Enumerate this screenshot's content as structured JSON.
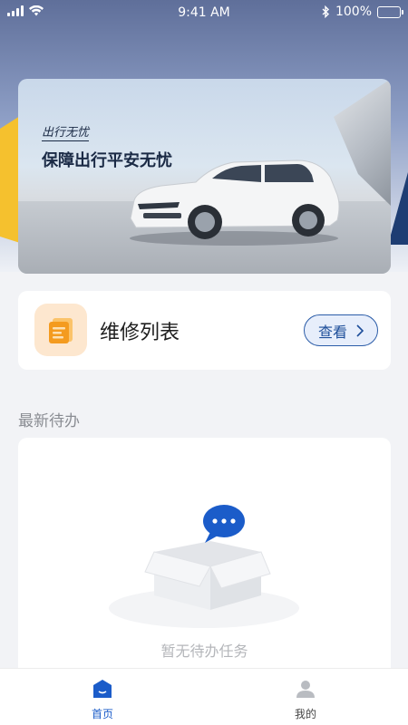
{
  "status_bar": {
    "time": "9:41 AM",
    "battery": "100%"
  },
  "banner": {
    "subtitle": "出行无忧",
    "title": "保障出行平安无忧"
  },
  "repair": {
    "title": "维修列表",
    "view_label": "查看"
  },
  "todo": {
    "section_title": "最新待办",
    "empty_text": "暂无待办任务"
  },
  "tabs": [
    {
      "label": "首页",
      "icon": "home-icon",
      "active": true
    },
    {
      "label": "我的",
      "icon": "user-icon",
      "active": false
    }
  ],
  "colors": {
    "primary": "#1b5cc9",
    "header_bg": "#5f6f9a",
    "accent_yellow": "#f5c12e"
  }
}
